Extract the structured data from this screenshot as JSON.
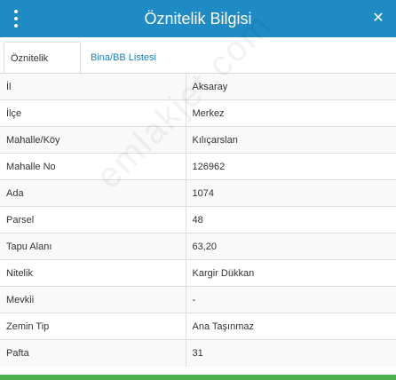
{
  "header": {
    "title": "Öznitelik Bilgisi",
    "close_glyph": "✕",
    "color": "#1f8bc4"
  },
  "tabs": [
    {
      "label": "Öznitelik Bilgisi",
      "active": true
    },
    {
      "label": "Bina/BB Listesi",
      "active": false
    }
  ],
  "rows": [
    {
      "key": "İl",
      "value": "Aksaray"
    },
    {
      "key": "İlçe",
      "value": "Merkez"
    },
    {
      "key": "Mahalle/Köy",
      "value": "Kılıçarslan"
    },
    {
      "key": "Mahalle No",
      "value": "126962"
    },
    {
      "key": "Ada",
      "value": "1074"
    },
    {
      "key": "Parsel",
      "value": "48"
    },
    {
      "key": "Tapu Alanı",
      "value": "63,20"
    },
    {
      "key": "Nitelik",
      "value": "Kargir Dükkan"
    },
    {
      "key": "Mevkii",
      "value": "-"
    },
    {
      "key": "Zemin Tip",
      "value": "Ana Taşınmaz"
    },
    {
      "key": "Pafta",
      "value": "31"
    }
  ],
  "watermark": "emlakjet.com",
  "accent_bottom": "#4caf50"
}
